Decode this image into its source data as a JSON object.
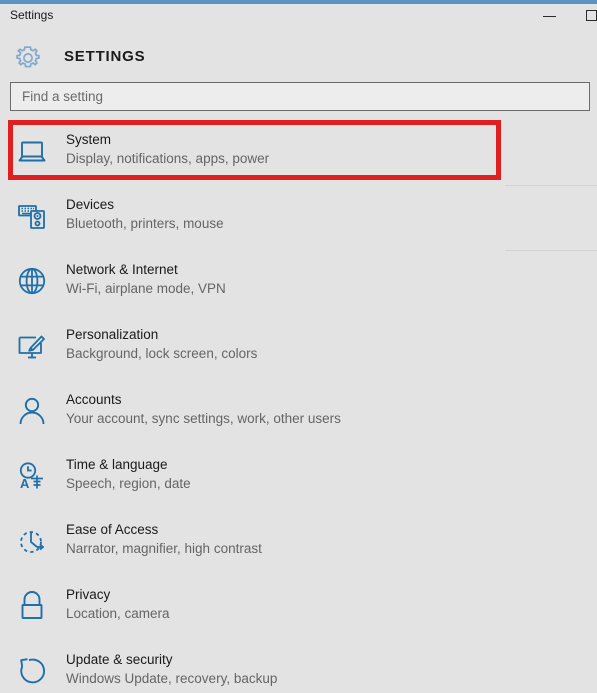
{
  "window": {
    "accent_color": "#5b93c2",
    "background_color": "#e3e3e3",
    "titlebar_text": "Settings",
    "controls": {
      "minimize_label": "Minimize",
      "maximize_label": "Maximize"
    }
  },
  "header": {
    "icon": "gear-icon",
    "title": "SETTINGS"
  },
  "search": {
    "placeholder": "Find a setting",
    "value": ""
  },
  "annotation": {
    "color": "#e02020",
    "target": "System",
    "shape": "rectangle"
  },
  "categories": [
    {
      "title": "System",
      "subtitle": "Display, notifications, apps, power",
      "icon": "laptop-icon",
      "highlighted": true
    },
    {
      "title": "Devices",
      "subtitle": "Bluetooth, printers, mouse",
      "icon": "devices-icon",
      "highlighted": false
    },
    {
      "title": "Network & Internet",
      "subtitle": "Wi-Fi, airplane mode, VPN",
      "icon": "globe-icon",
      "highlighted": false
    },
    {
      "title": "Personalization",
      "subtitle": "Background, lock screen, colors",
      "icon": "paintbrush-monitor-icon",
      "highlighted": false
    },
    {
      "title": "Accounts",
      "subtitle": "Your account, sync settings, work, other users",
      "icon": "person-icon",
      "highlighted": false
    },
    {
      "title": "Time & language",
      "subtitle": "Speech, region, date",
      "icon": "clock-language-icon",
      "highlighted": false
    },
    {
      "title": "Ease of Access",
      "subtitle": "Narrator, magnifier, high contrast",
      "icon": "ease-of-access-icon",
      "highlighted": false
    },
    {
      "title": "Privacy",
      "subtitle": "Location, camera",
      "icon": "lock-icon",
      "highlighted": false
    },
    {
      "title": "Update & security",
      "subtitle": "Windows Update, recovery, backup",
      "icon": "refresh-icon",
      "highlighted": false
    }
  ]
}
